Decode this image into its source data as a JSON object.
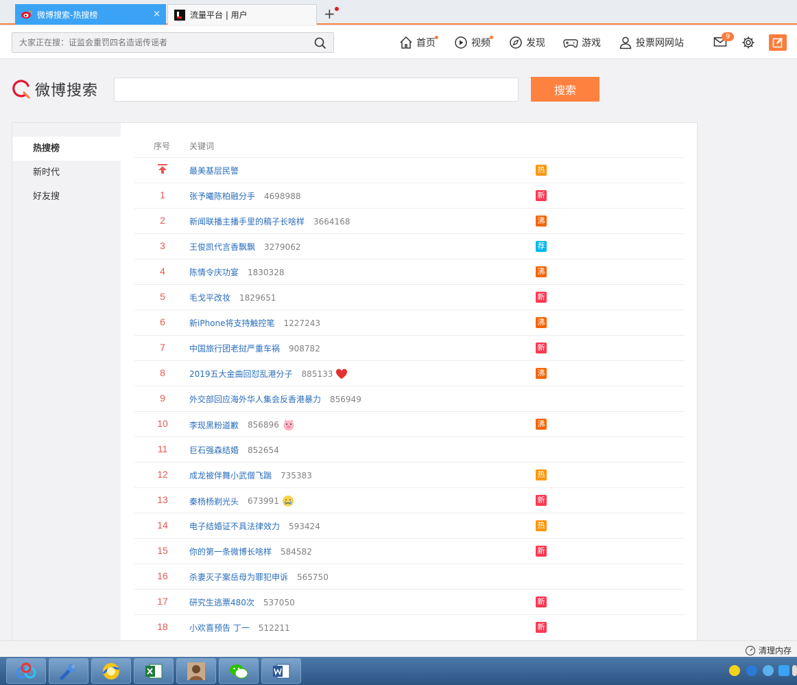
{
  "browser": {
    "tabs": [
      {
        "title": "微博搜索-热搜榜",
        "close": "×"
      },
      {
        "title": "流量平台 | 用户"
      }
    ],
    "new_tab": "+"
  },
  "nav": {
    "search_placeholder": "大家正在搜：证监会重罚四名造谣传谣者",
    "items": [
      {
        "label": "首页",
        "icon": "home-icon"
      },
      {
        "label": "视频",
        "icon": "video-icon"
      },
      {
        "label": "发现",
        "icon": "compass-icon"
      },
      {
        "label": "游戏",
        "icon": "gamepad-icon"
      },
      {
        "label": "投票网网站",
        "icon": "user-icon"
      }
    ],
    "message_count": "9"
  },
  "header": {
    "logo_text": "微博搜索",
    "search_button": "搜索"
  },
  "sidebar": {
    "items": [
      {
        "label": "热搜榜",
        "active": true
      },
      {
        "label": "新时代"
      },
      {
        "label": "好友搜"
      }
    ]
  },
  "table": {
    "col_rank": "序号",
    "col_keyword": "关键词",
    "rows": [
      {
        "rank": "",
        "pinned": true,
        "keyword": "最美基层民警",
        "count": "",
        "tag": "热"
      },
      {
        "rank": "1",
        "keyword": "张予曦陈柏融分手",
        "count": "4698988",
        "tag": "新"
      },
      {
        "rank": "2",
        "keyword": "新闻联播主播手里的稿子长啥样",
        "count": "3664168",
        "tag": "沸"
      },
      {
        "rank": "3",
        "keyword": "王俊凯代言香飘飘",
        "count": "3279062",
        "tag": "荐"
      },
      {
        "rank": "4",
        "keyword": "陈情令庆功宴",
        "count": "1830328",
        "tag": "沸"
      },
      {
        "rank": "5",
        "keyword": "毛戈平改妆",
        "count": "1829651",
        "tag": "新"
      },
      {
        "rank": "6",
        "keyword": "新iPhone将支持触控笔",
        "count": "1227243",
        "tag": "沸"
      },
      {
        "rank": "7",
        "keyword": "中国旅行团老挝严重车祸",
        "count": "908782",
        "tag": "新"
      },
      {
        "rank": "8",
        "keyword": "2019五大金曲回怼乱港分子",
        "count": "885133",
        "emoji": "heart",
        "tag": "沸"
      },
      {
        "rank": "9",
        "keyword": "外交部回应海外华人集会反香港暴力",
        "count": "856949",
        "tag": ""
      },
      {
        "rank": "10",
        "keyword": "李现黑粉道歉",
        "count": "856896",
        "emoji": "pig",
        "tag": "沸"
      },
      {
        "rank": "11",
        "keyword": "巨石强森结婚",
        "count": "852654",
        "tag": ""
      },
      {
        "rank": "12",
        "keyword": "成龙被伴舞小武僧飞踹",
        "count": "735383",
        "tag": "热"
      },
      {
        "rank": "13",
        "keyword": "秦杨杨剃光头",
        "count": "673991",
        "emoji": "cry",
        "tag": "新"
      },
      {
        "rank": "14",
        "keyword": "电子结婚证不具法律效力",
        "count": "593424",
        "tag": "热"
      },
      {
        "rank": "15",
        "keyword": "你的第一条微博长啥样",
        "count": "584582",
        "tag": "新"
      },
      {
        "rank": "16",
        "keyword": "杀妻灭子案岳母为罪犯申诉",
        "count": "565750",
        "tag": ""
      },
      {
        "rank": "17",
        "keyword": "研究生逃票480次",
        "count": "537050",
        "tag": "新"
      },
      {
        "rank": "18",
        "keyword": "小欢喜预告 丁一",
        "count": "512211",
        "tag": "新"
      }
    ]
  },
  "tag_colors": {
    "热": "#ff9406",
    "新": "#ff3852",
    "沸": "#f86400",
    "荐": "#00b7ee"
  },
  "status": {
    "clear_memory": "清理内存"
  },
  "taskbar": {
    "apps": [
      "baidu-netdisk-icon",
      "tools-icon",
      "qq-browser-icon",
      "excel-icon",
      "photo-icon",
      "wechat-icon",
      "word-icon"
    ]
  }
}
